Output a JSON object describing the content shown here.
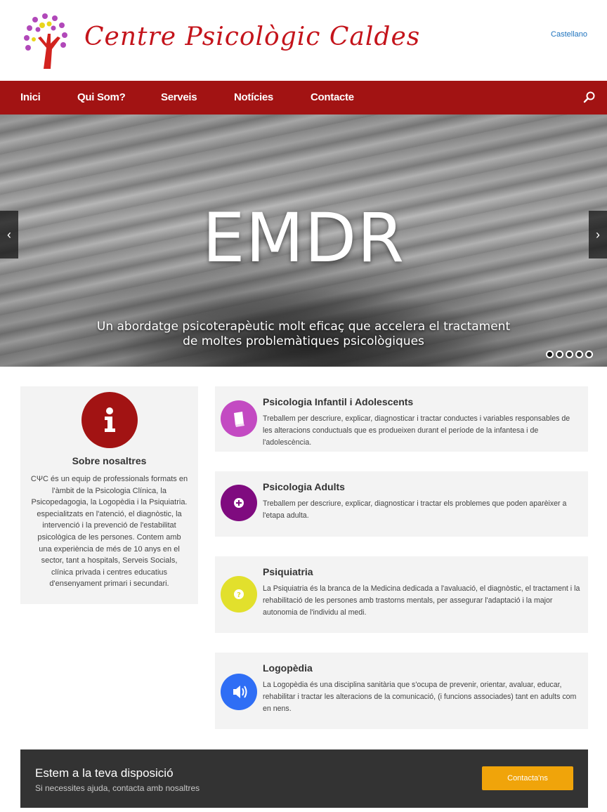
{
  "header": {
    "site_title": "Centre Psicològic Caldes",
    "lang_link": "Castellano"
  },
  "nav": {
    "items": [
      {
        "label": "Inici"
      },
      {
        "label": "Qui Som?"
      },
      {
        "label": "Serveis"
      },
      {
        "label": "Notícies"
      },
      {
        "label": "Contacte"
      }
    ],
    "search_icon": "search-icon"
  },
  "hero": {
    "title": "EMDR",
    "subtitle": "Un abordatge psicoterapèutic molt eficaç que accelera el tractament de moltes problemàtiques psicològiques",
    "prev_arrow": "‹",
    "next_arrow": "›",
    "slide_count": 5,
    "active_slide": 1
  },
  "about": {
    "icon": "info-icon",
    "color": "#a21313",
    "title": "Sobre nosaltres",
    "text": "CΨC és un equip de professionals formats en l'àmbit de la Psicologia Clínica, la Psicopedagogia, la Logopèdia i la Psiquiatria. especialitzats en l'atenció, el diagnòstic, la intervenció i la prevenció de l'estabilitat psicològica de les persones. Contem amb una experiència de més de 10 anys en el sector, tant a hospitals, Serveis Socials, clínica privada i centres educatius d'ensenyament primari i secundari."
  },
  "services": [
    {
      "title": "Psicologia Infantil i Adolescents",
      "text": "Treballem per descriure, explicar, diagnosticar i tractar conductes i variables responsables de les alteracions conductuals que es produeixen durant el període de la infantesa i de l'adolescència.",
      "icon": "book-icon",
      "color": "#c34ac2"
    },
    {
      "title": "Psicologia Adults",
      "text": "Treballem per descriure, explicar, diagnosticar i tractar els problemes que poden aparèixer a l'etapa adulta.",
      "icon": "plus-circle-icon",
      "color": "#7f0b7f"
    },
    {
      "title": "Psiquiatria",
      "text": "La Psiquiatria és la branca de la Medicina dedicada a l'avaluació, el diagnòstic, el tractament i la rehabilitació de les persones amb trastorns mentals, per assegurar l'adaptació i la major autonomia de l'individu al medi.",
      "icon": "question-circle-icon",
      "color": "#e2e02c"
    },
    {
      "title": "Logopèdia",
      "text": "La Logopèdia és una disciplina sanitària que s'ocupa de prevenir, orientar, avaluar, educar, rehabilitar i tractar les alteracions de la comunicació, (i funcions associades) tant en adults com en nens.",
      "icon": "speaker-icon",
      "color": "#2f6ef5"
    }
  ],
  "cta": {
    "title": "Estem a la teva disposició",
    "subtitle": "Si necessites ajuda, contacta amb nosaltres",
    "button": "Contacta'ns",
    "button_color": "#f0a40a"
  }
}
